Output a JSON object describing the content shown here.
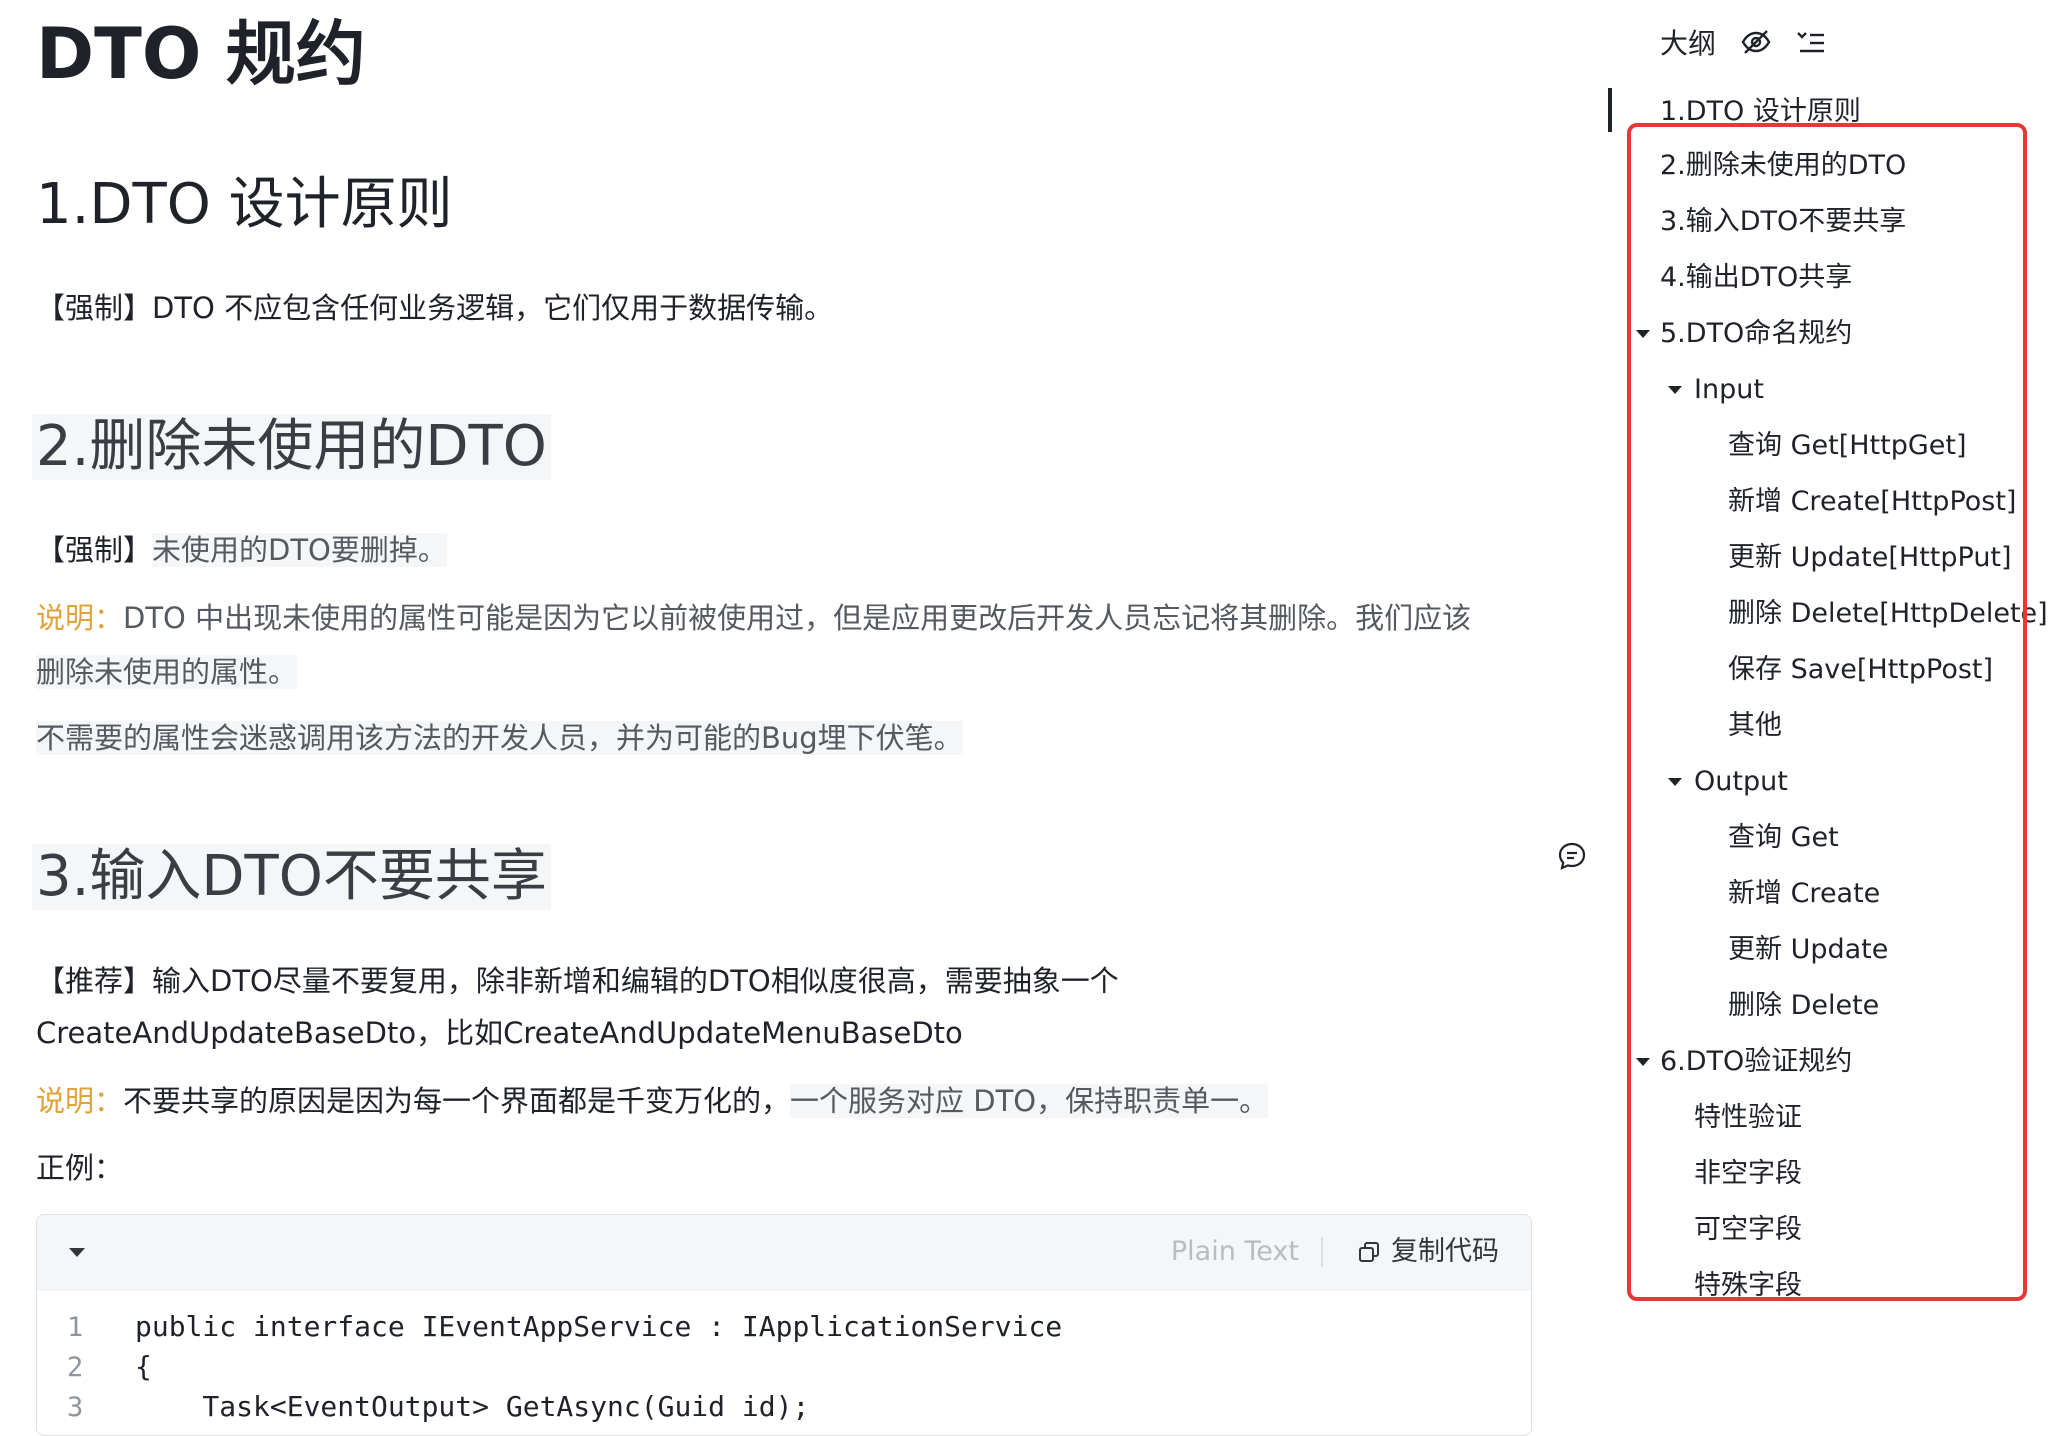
{
  "doc": {
    "title": "DTO 规约",
    "s1": {
      "heading": "1.DTO 设计原则",
      "p1": "【强制】DTO 不应包含任何业务逻辑，它们仅用于数据传输。"
    },
    "s2": {
      "heading": "2.删除未使用的DTO",
      "p1_tag": "【强制】",
      "p1_text": "未使用的DTO要删掉。",
      "note_label": "说明：",
      "note_line1": "DTO 中出现未使用的属性可能是因为它以前被使用过，但是应用更改后开发人员忘记将其删除。我们应该",
      "note_line2": "删除未使用的属性。",
      "p3": "不需要的属性会迷惑调用该方法的开发人员，并为可能的Bug埋下伏笔。"
    },
    "s3": {
      "heading": "3.输入DTO不要共享",
      "p1_line1": "【推荐】输入DTO尽量不要复用，除非新增和编辑的DTO相似度很高，需要抽象一个",
      "p1_line2": "CreateAndUpdateBaseDto，比如CreateAndUpdateMenuBaseDto",
      "note_label": "说明：",
      "note_text_a": "不要共享的原因是因为每一个界面都是千变万化的，",
      "note_text_b": "一个服务对应 DTO，保持职责单一。",
      "example_label": "正例："
    },
    "code": {
      "language": "Plain Text",
      "copy_label": "复制代码",
      "lines": [
        {
          "n": "1",
          "text": "public interface IEventAppService : IApplicationService"
        },
        {
          "n": "2",
          "text": "{"
        },
        {
          "n": "3",
          "text": "    Task<EventOutput> GetAsync(Guid id);"
        }
      ]
    }
  },
  "outline": {
    "title": "大纲",
    "items": [
      "1.DTO 设计原则",
      "2.删除未使用的DTO",
      "3.输入DTO不要共享",
      "4.输出DTO共享",
      "5.DTO命名规约",
      "Input",
      "查询 Get[HttpGet]",
      "新增 Create[HttpPost]",
      "更新 Update[HttpPut]",
      "删除 Delete[HttpDelete]",
      "保存 Save[HttpPost]",
      "其他",
      "Output",
      "查询 Get",
      "新增 Create",
      "更新 Update",
      "删除 Delete",
      "6.DTO验证规约",
      "特性验证",
      "非空字段",
      "可空字段",
      "特殊字段"
    ]
  },
  "colors": {
    "accent_note": "#e0a23a",
    "highlight_box": "#e53935",
    "text": "#1f2329"
  }
}
